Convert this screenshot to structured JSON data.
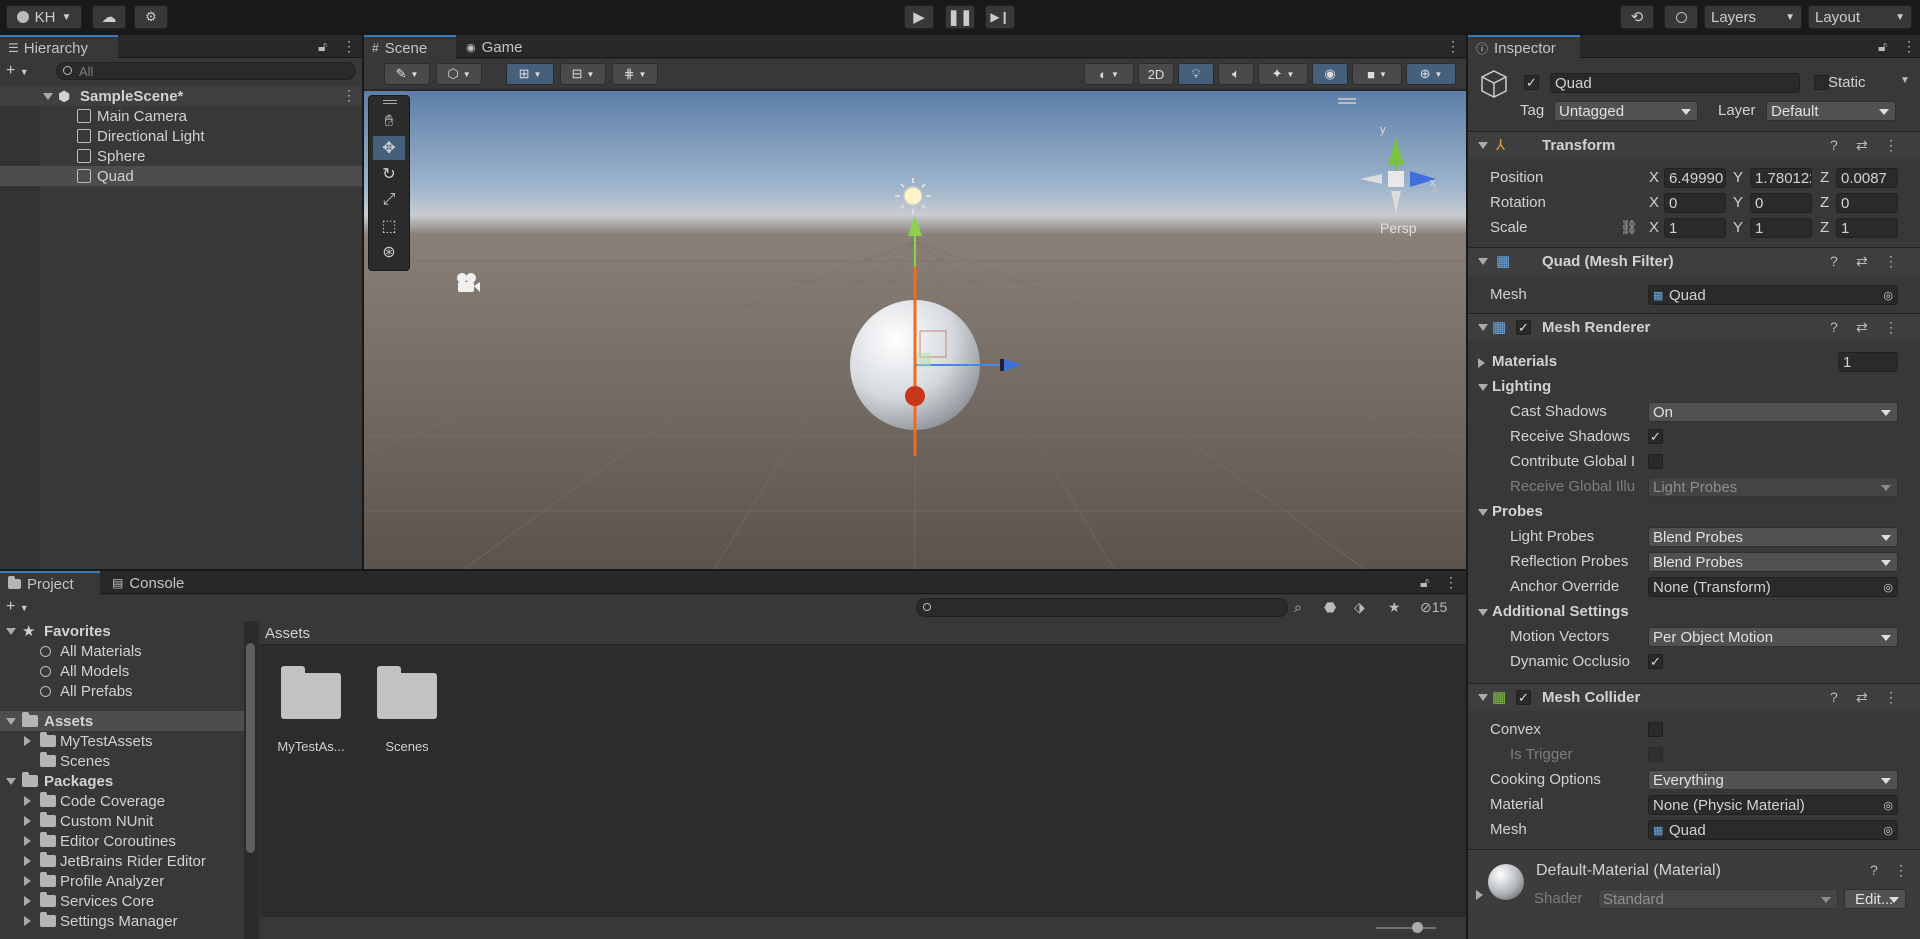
{
  "toolbar": {
    "account": "KH",
    "layers": "Layers",
    "layout": "Layout"
  },
  "hierarchy": {
    "tab": "Hierarchy",
    "search_placeholder": "All",
    "scene": "SampleScene*",
    "items": [
      "Main Camera",
      "Directional Light",
      "Sphere",
      "Quad"
    ],
    "selected": "Quad"
  },
  "scene_view": {
    "tabs": [
      "Scene",
      "Game"
    ],
    "btn_2d": "2D",
    "persp": "Persp",
    "gizmo_y": "y",
    "gizmo_x": "x"
  },
  "project": {
    "tabs": [
      "Project",
      "Console"
    ],
    "count": "15",
    "favorites_label": "Favorites",
    "favorites": [
      "All Materials",
      "All Models",
      "All Prefabs"
    ],
    "assets_label": "Assets",
    "assets": [
      "MyTestAssets",
      "Scenes"
    ],
    "packages_label": "Packages",
    "packages": [
      "Code Coverage",
      "Custom NUnit",
      "Editor Coroutines",
      "JetBrains Rider Editor",
      "Profile Analyzer",
      "Services Core",
      "Settings Manager"
    ],
    "breadcrumb": "Assets",
    "grid_items": [
      "MyTestAs...",
      "Scenes"
    ]
  },
  "inspector": {
    "tab": "Inspector",
    "object_name": "Quad",
    "static_label": "Static",
    "tag_label": "Tag",
    "tag_value": "Untagged",
    "layer_label": "Layer",
    "layer_value": "Default",
    "transform": {
      "title": "Transform",
      "position_label": "Position",
      "rotation_label": "Rotation",
      "scale_label": "Scale",
      "position": {
        "x": "6.49990",
        "y": "1.780122",
        "z": "0.0087"
      },
      "rotation": {
        "x": "0",
        "y": "0",
        "z": "0"
      },
      "scale": {
        "x": "1",
        "y": "1",
        "z": "1"
      },
      "axis_x": "X",
      "axis_y": "Y",
      "axis_z": "Z"
    },
    "mesh_filter": {
      "title": "Quad (Mesh Filter)",
      "mesh_label": "Mesh",
      "mesh_value": "Quad"
    },
    "mesh_renderer": {
      "title": "Mesh Renderer",
      "materials_label": "Materials",
      "materials_count": "1",
      "lighting_label": "Lighting",
      "cast_shadows_label": "Cast Shadows",
      "cast_shadows_value": "On",
      "receive_shadows_label": "Receive Shadows",
      "contribute_gi_label": "Contribute Global I",
      "receive_gi_label": "Receive Global Illu",
      "receive_gi_value": "Light Probes",
      "probes_label": "Probes",
      "light_probes_label": "Light Probes",
      "light_probes_value": "Blend Probes",
      "reflection_probes_label": "Reflection Probes",
      "reflection_probes_value": "Blend Probes",
      "anchor_label": "Anchor Override",
      "anchor_value": "None (Transform)",
      "additional_label": "Additional Settings",
      "motion_vectors_label": "Motion Vectors",
      "motion_vectors_value": "Per Object Motion",
      "dynamic_occlusion_label": "Dynamic Occlusio"
    },
    "mesh_collider": {
      "title": "Mesh Collider",
      "convex_label": "Convex",
      "is_trigger_label": "Is Trigger",
      "cooking_label": "Cooking Options",
      "cooking_value": "Everything",
      "material_label": "Material",
      "material_value": "None (Physic Material)",
      "mesh_label": "Mesh",
      "mesh_value": "Quad"
    },
    "material": {
      "title": "Default-Material (Material)",
      "shader_label": "Shader",
      "shader_value": "Standard",
      "edit_label": "Edit..."
    }
  }
}
